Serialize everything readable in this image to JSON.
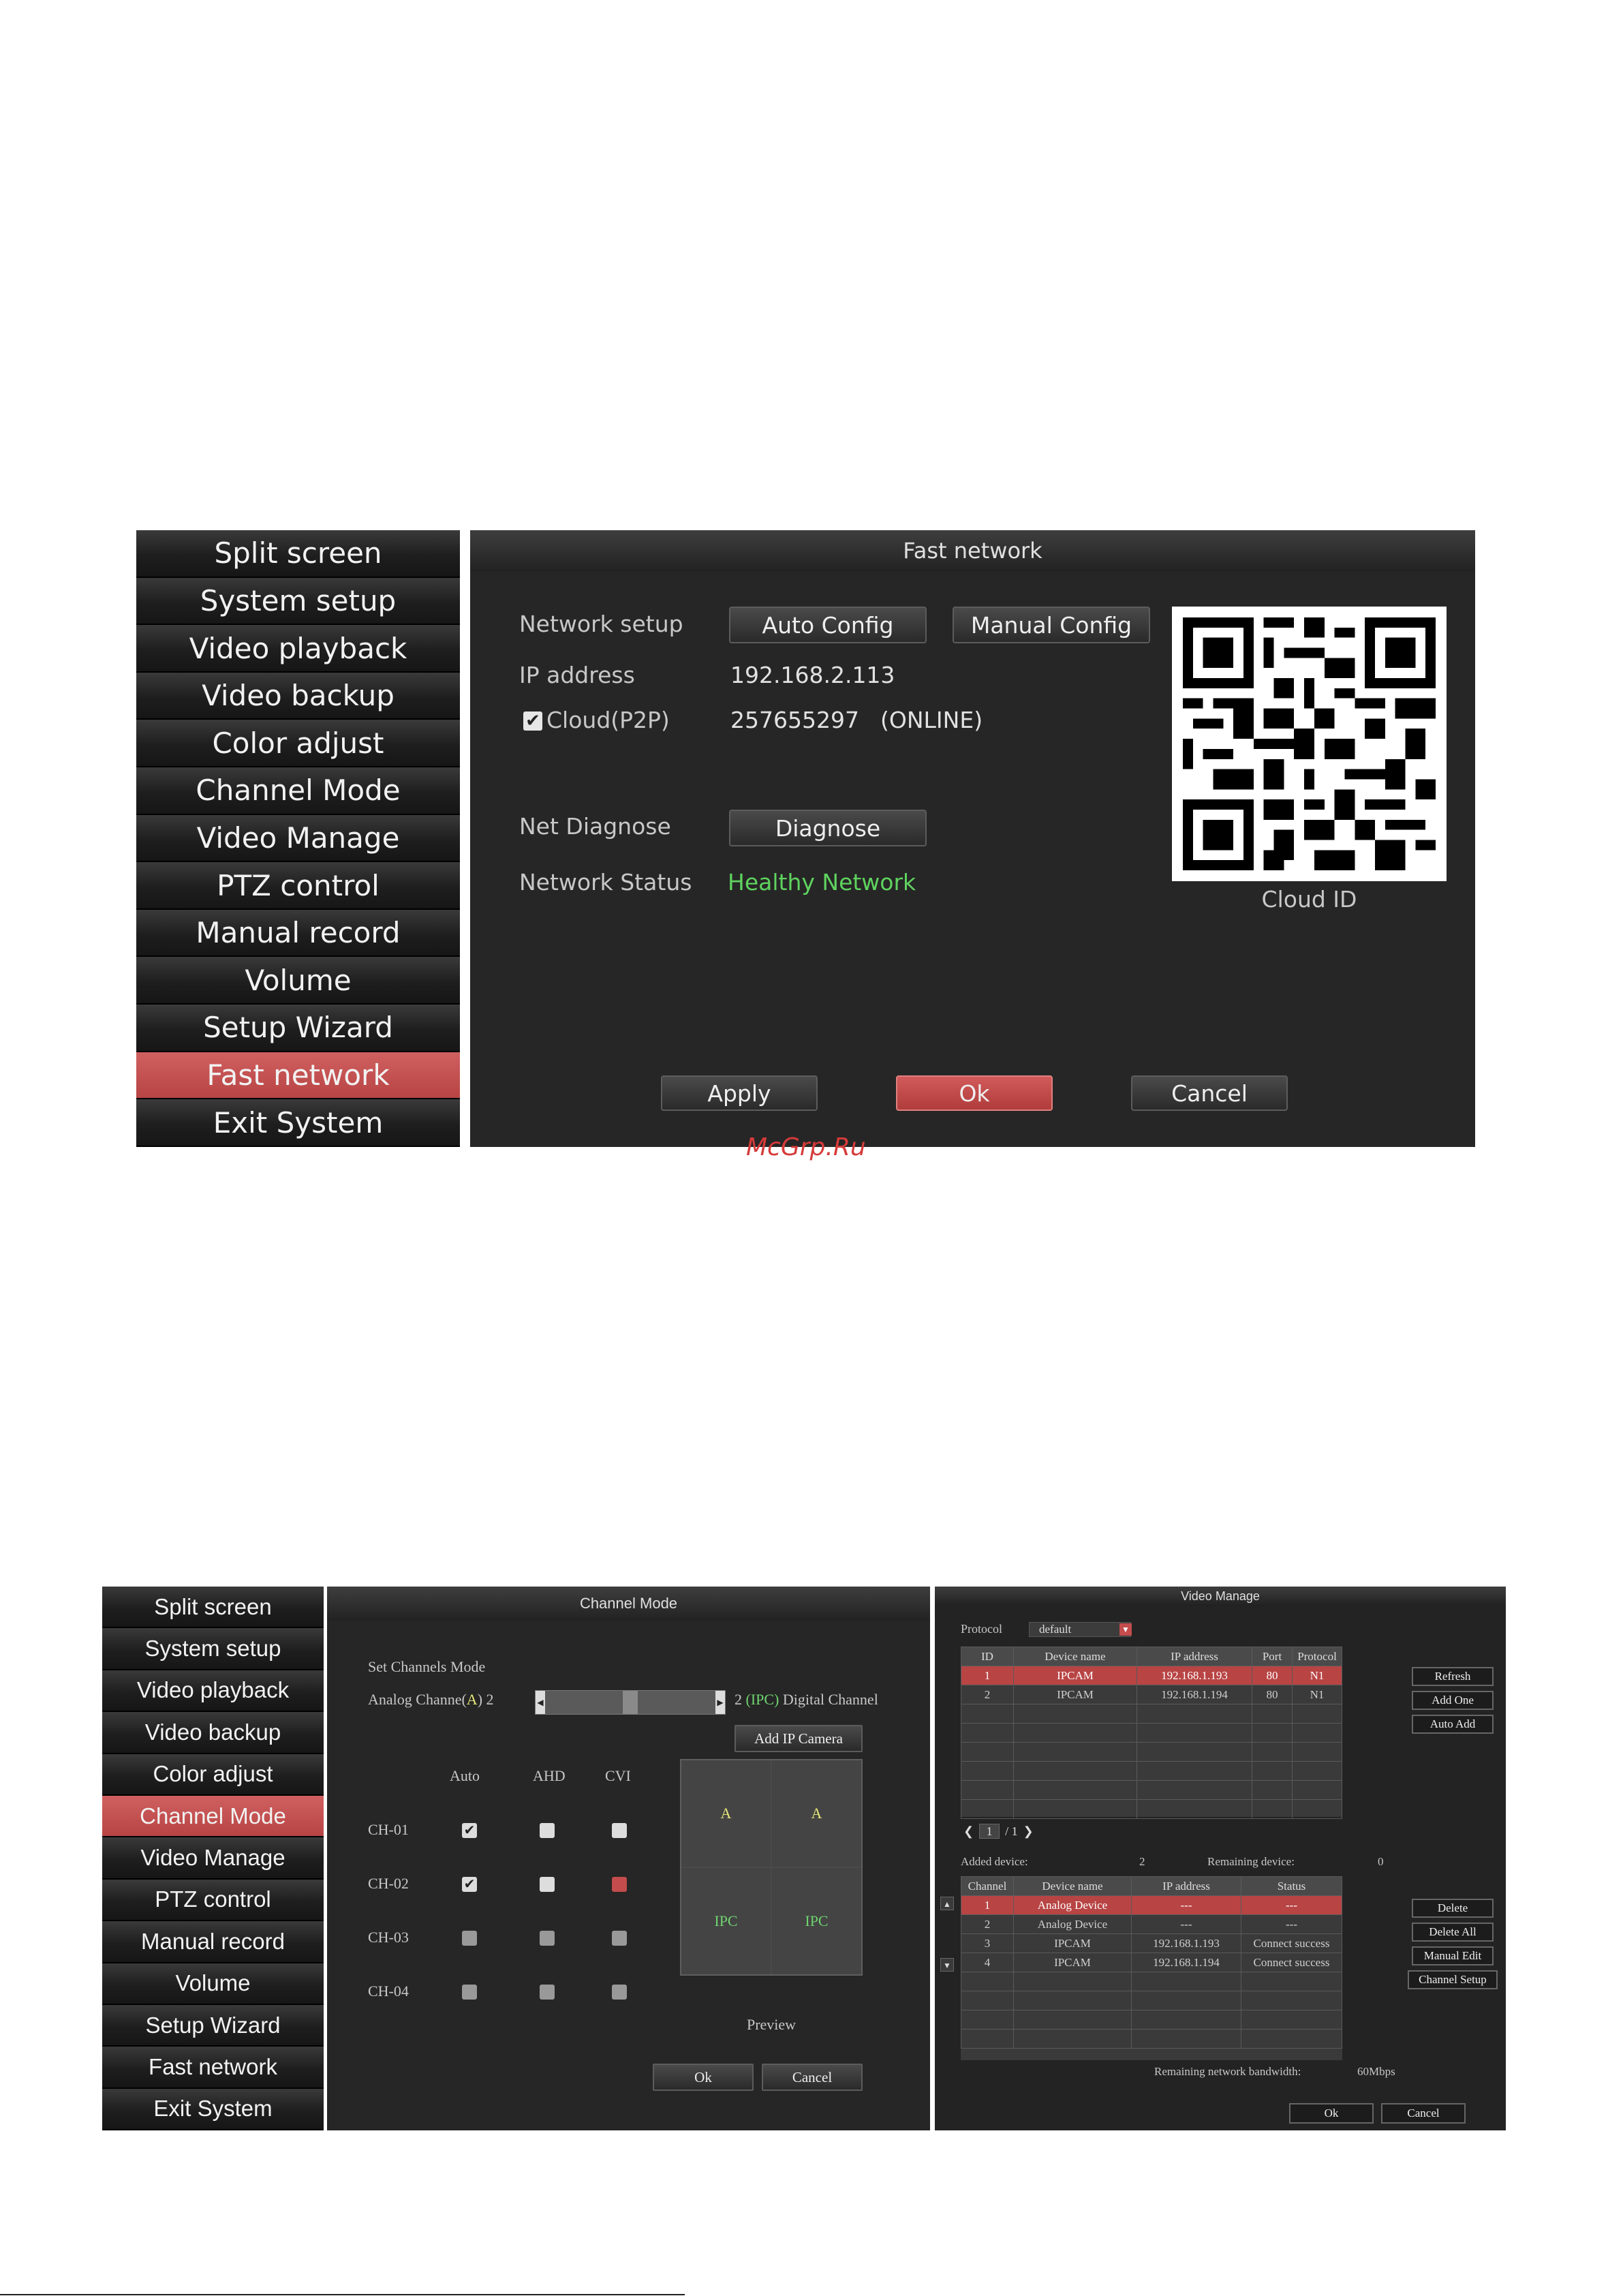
{
  "menu": {
    "items": [
      "Split screen",
      "System setup",
      "Video playback",
      "Video backup",
      "Color adjust",
      "Channel Mode",
      "Video Manage",
      "PTZ control",
      "Manual record",
      "Volume",
      "Setup Wizard",
      "Fast network",
      "Exit System"
    ]
  },
  "fast_network": {
    "title": "Fast network",
    "network_setup_label": "Network setup",
    "auto_config": "Auto Config",
    "manual_config": "Manual Config",
    "ip_label": "IP address",
    "ip_value": "192.168.2.113",
    "cloud_label": "Cloud(P2P)",
    "cloud_value": "257655297",
    "cloud_status": "(ONLINE)",
    "diagnose_label": "Net Diagnose",
    "diagnose_button": "Diagnose",
    "status_label": "Network Status",
    "status_value": "Healthy Network",
    "cloud_id_label": "Cloud ID",
    "apply": "Apply",
    "ok": "Ok",
    "cancel": "Cancel"
  },
  "watermark": "McGrp.Ru",
  "channel_mode": {
    "title": "Channel Mode",
    "set_label": "Set Channels Mode",
    "analog_label": "Analog Channe(",
    "analog_letter": "A",
    "analog_close": ")",
    "analog_count": "2",
    "digital_count": "2",
    "ipc_tag": "(IPC)",
    "digital_label": "Digital Channel",
    "add_ip_camera": "Add IP Camera",
    "col_auto": "Auto",
    "col_ahd": "AHD",
    "col_cvi": "CVI",
    "channels": [
      "CH-01",
      "CH-02",
      "CH-03",
      "CH-04"
    ],
    "preview_cells": [
      "A",
      "A",
      "IPC",
      "IPC"
    ],
    "preview_label": "Preview",
    "ok": "Ok",
    "cancel": "Cancel"
  },
  "video_manage": {
    "title": "Video Manage",
    "protocol_label": "Protocol",
    "protocol_value": "default",
    "top_headers": [
      "ID",
      "Device name",
      "IP address",
      "Port",
      "Protocol"
    ],
    "top_rows": [
      [
        "1",
        "IPCAM",
        "192.168.1.193",
        "80",
        "N1"
      ],
      [
        "2",
        "IPCAM",
        "192.168.1.194",
        "80",
        "N1"
      ]
    ],
    "refresh": "Refresh",
    "add_one": "Add One",
    "auto_add": "Auto Add",
    "pager": "1",
    "pager_total": "/ 1",
    "added_label": "Added device:",
    "added_value": "2",
    "remaining_label": "Remaining device:",
    "remaining_value": "0",
    "bottom_headers": [
      "Channel",
      "Device name",
      "IP address",
      "Status"
    ],
    "bottom_rows": [
      [
        "1",
        "Analog Device",
        "---",
        "---"
      ],
      [
        "2",
        "Analog Device",
        "---",
        "---"
      ],
      [
        "3",
        "IPCAM",
        "192.168.1.193",
        "Connect success"
      ],
      [
        "4",
        "IPCAM",
        "192.168.1.194",
        "Connect success"
      ]
    ],
    "delete": "Delete",
    "delete_all": "Delete All",
    "manual_edit": "Manual Edit",
    "channel_setup": "Channel Setup",
    "bandwidth_label": "Remaining network bandwidth:",
    "bandwidth_value": "60Mbps",
    "ok": "Ok",
    "cancel": "Cancel"
  }
}
